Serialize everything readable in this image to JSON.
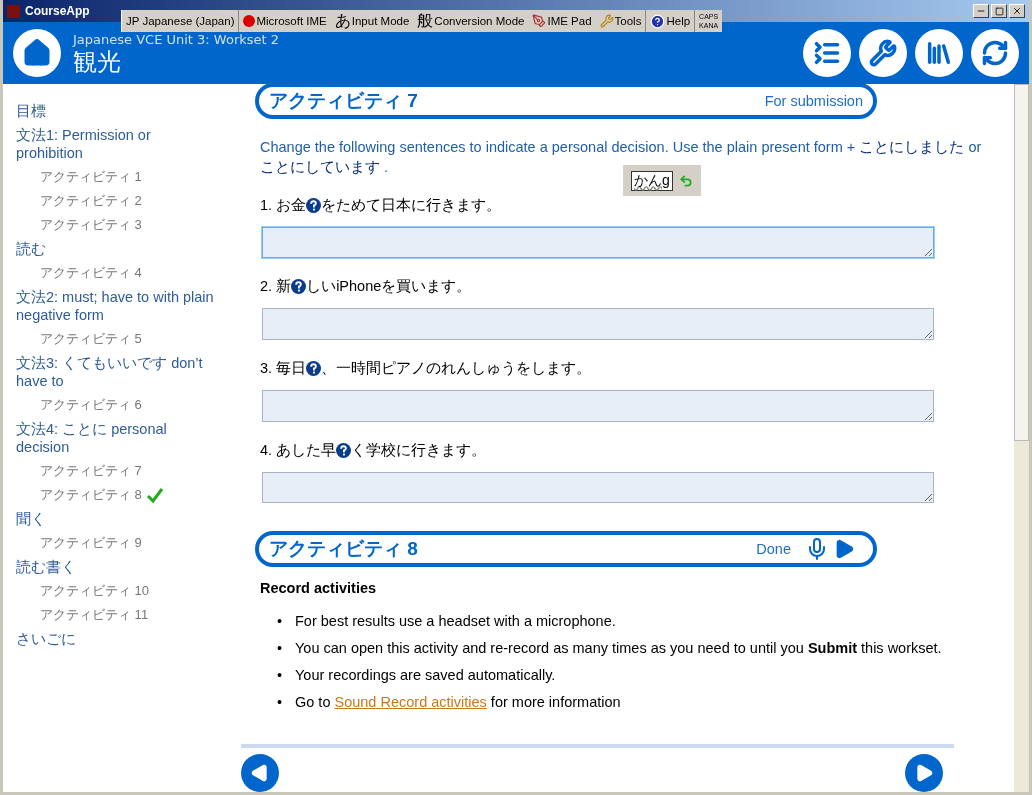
{
  "window": {
    "title": "CourseApp"
  },
  "ime_toolbar": [
    {
      "label": "JP Japanese (Japan)",
      "kind": "language"
    },
    {
      "label": "Microsoft IME",
      "kind": "ime"
    },
    {
      "icon_text": "あ",
      "label": "Input Mode",
      "kind": "glyph"
    },
    {
      "icon_text": "般",
      "label": "Conversion Mode",
      "kind": "glyph"
    },
    {
      "label": "IME Pad",
      "kind": "pad"
    },
    {
      "label": "Tools",
      "kind": "tools"
    },
    {
      "label": "Help",
      "kind": "help"
    }
  ],
  "ime_status": [
    "CAPS",
    "KANA"
  ],
  "header": {
    "subtitle": "Japanese VCE Unit 3: Workset 2",
    "title": "観光"
  },
  "sidebar": {
    "items": [
      {
        "label": "目標"
      },
      {
        "label": "文法1: Permission or prohibition",
        "children": [
          {
            "label": "アクティビティ 1",
            "done": false
          },
          {
            "label": "アクティビティ 2",
            "done": false
          },
          {
            "label": "アクティビティ 3",
            "done": false
          }
        ]
      },
      {
        "label": "読む",
        "children": [
          {
            "label": "アクティビティ 4",
            "done": false
          }
        ]
      },
      {
        "label": "文法2: must; have to with plain negative form",
        "children": [
          {
            "label": "アクティビティ 5",
            "done": false
          }
        ]
      },
      {
        "label": "文法3: くてもいいです don’t have to",
        "children": [
          {
            "label": "アクティビティ 6",
            "done": false
          }
        ]
      },
      {
        "label": "文法4: ことに personal decision",
        "children": [
          {
            "label": "アクティビティ 7",
            "done": false
          },
          {
            "label": "アクティビティ 8",
            "done": true
          }
        ]
      },
      {
        "label": "聞く",
        "children": [
          {
            "label": "アクティビティ 9",
            "done": false
          }
        ]
      },
      {
        "label": "読む書く",
        "children": [
          {
            "label": "アクティビティ 10",
            "done": false
          },
          {
            "label": "アクティビティ 11",
            "done": false
          }
        ]
      },
      {
        "label": "さいごに"
      }
    ]
  },
  "activity_7": {
    "title": "アクティビティ 7",
    "status": "For submission",
    "kind": "submission",
    "instruction": [
      {
        "text": "Change the following sentences to indicate a personal decision. Use the plain present form +",
        "kind": "en"
      },
      {
        "text": "ことにしました",
        "kind": "jp"
      },
      {
        "text": "or",
        "kind": "en"
      },
      {
        "text": "ことにしています",
        "kind": "jp"
      },
      {
        "text": ".",
        "kind": "en"
      }
    ],
    "ime_composition": "かんg",
    "questions": [
      {
        "number": "1.",
        "before": "お金",
        "after": "をためて日本に行きます。"
      },
      {
        "number": "2.",
        "before": "新",
        "after": "しいiPhoneを買います。"
      },
      {
        "number": "3.",
        "before": "毎日",
        "after": "、一時間ピアノのれんしゅうをします。"
      },
      {
        "number": "4.",
        "before": "あした早",
        "after": "く学校に行きます。"
      }
    ]
  },
  "activity_8": {
    "title": "アクティビティ 8",
    "status": "Done",
    "kind": "record",
    "heading": "Record activities",
    "bullets": [
      {
        "kind": "text",
        "marker": "•",
        "text": "For best results use a headset with a microphone."
      },
      {
        "kind": "text",
        "marker": "•",
        "text": "You can open this activity and re-record as many times as you need to until you **Submit** this workset."
      },
      {
        "kind": "text",
        "marker": "•",
        "text": "Your recordings are saved automatically."
      },
      {
        "kind": "link",
        "marker": "•",
        "before": "Go to",
        "link": "Sound Record activities",
        "after": "for more information"
      }
    ]
  }
}
